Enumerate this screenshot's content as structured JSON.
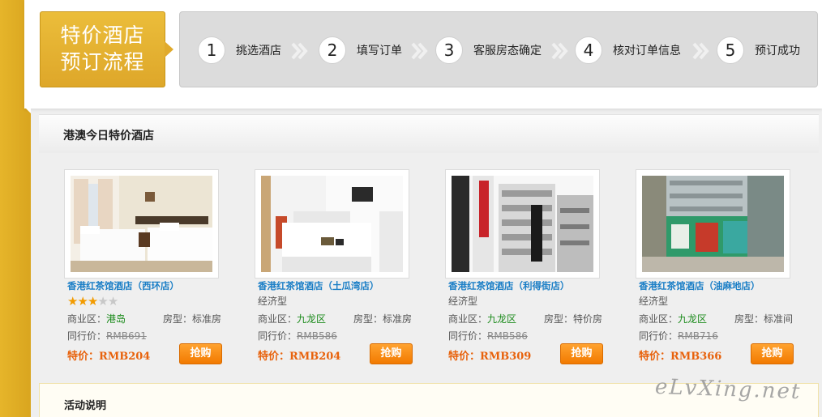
{
  "process": {
    "title_line1": "特价酒店",
    "title_line2": "预订流程",
    "steps": [
      {
        "num": "1",
        "label": "挑选酒店"
      },
      {
        "num": "2",
        "label": "填写订单"
      },
      {
        "num": "3",
        "label": "客服房态确定"
      },
      {
        "num": "4",
        "label": "核对订单信息"
      },
      {
        "num": "5",
        "label": "预订成功"
      }
    ]
  },
  "section": {
    "title": "港澳今日特价酒店"
  },
  "labels": {
    "district": "商业区：",
    "room_type": "房型：",
    "peer_price": "同行价：",
    "special": "特价：",
    "buy": "抢购"
  },
  "hotels": [
    {
      "name": "香港红茶馆酒店（西环店）",
      "stars": 3,
      "type": "",
      "district": "港岛",
      "room_type": "标准房",
      "peer_price": "RMB691",
      "special_price": "RMB204"
    },
    {
      "name": "香港红茶馆酒店（土瓜湾店）",
      "stars": 0,
      "type": "经济型",
      "district": "九龙区",
      "room_type": "标准房",
      "peer_price": "RMB586",
      "special_price": "RMB204"
    },
    {
      "name": "香港红茶馆酒店（利得街店）",
      "stars": 0,
      "type": "经济型",
      "district": "九龙区",
      "room_type": "特价房",
      "peer_price": "RMB586",
      "special_price": "RMB309"
    },
    {
      "name": "香港红茶馆酒店（油麻地店）",
      "stars": 0,
      "type": "经济型",
      "district": "九龙区",
      "room_type": "标准间",
      "peer_price": "RMB716",
      "special_price": "RMB366"
    }
  ],
  "activity": {
    "title": "活动说明"
  },
  "watermark": "eLvXing.net",
  "colors": {
    "gold": "#e2ae2c",
    "link_blue": "#1a7ec6",
    "price_orange": "#e8620c",
    "district_green": "#1a8a1a",
    "button_orange": "#f58a10"
  }
}
